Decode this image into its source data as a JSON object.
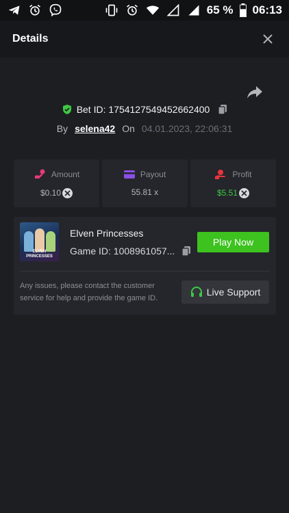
{
  "status_bar": {
    "battery": "65 %",
    "time": "06:13",
    "left_icons": [
      "telegram-icon",
      "alarm-icon",
      "viber-icon"
    ],
    "right_icons": [
      "vibrate-icon",
      "alarm-icon",
      "wifi-icon",
      "signal-empty-icon",
      "signal-icon",
      "battery-icon"
    ]
  },
  "header": {
    "title": "Details",
    "close_icon": "close-icon"
  },
  "bet": {
    "id_label": "Bet ID: 1754127549452662400",
    "by_label": "By",
    "username": "selena42",
    "on_label": "On",
    "date": "04.01.2023, 22:06:31"
  },
  "stats": {
    "amount": {
      "label": "Amount",
      "value": "$0.10",
      "icon": "coins-icon"
    },
    "payout": {
      "label": "Payout",
      "value": "55.81 x",
      "icon": "card-icon"
    },
    "profit": {
      "label": "Profit",
      "value": "$5.51",
      "icon": "hand-coin-icon"
    }
  },
  "game": {
    "name": "Elven Princesses",
    "id_label": "Game ID: 1008961057...",
    "play_label": "Play Now",
    "thumb_logo_line1": "ELVEN",
    "thumb_logo_line2": "PRINCESSES",
    "issue_text": "Any issues, please contact the customer service for help and provide the game ID.",
    "support_label": "Live Support"
  },
  "colors": {
    "background": "#1d1e22",
    "card": "#25262b",
    "accent_green": "#3dc21f",
    "profit_green": "#3dc943",
    "amount_icon": "#e83a7a",
    "payout_icon": "#8a4fe6",
    "profit_icon": "#e8343c"
  }
}
